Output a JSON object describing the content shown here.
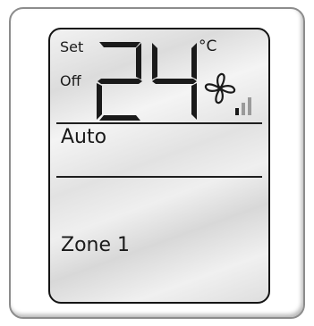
{
  "thermostat": {
    "set_label": "Set",
    "off_label": "Off",
    "temperature": "24",
    "unit": "°C",
    "mode": "Auto",
    "zone": "Zone 1",
    "fan_speed_level": "1 of 3",
    "icons": [
      "fan-icon",
      "fan-speed-bars-icon"
    ],
    "colors": {
      "lcd_text": "#1a1a1a",
      "inactive_bars": "#9a9a9a"
    }
  }
}
